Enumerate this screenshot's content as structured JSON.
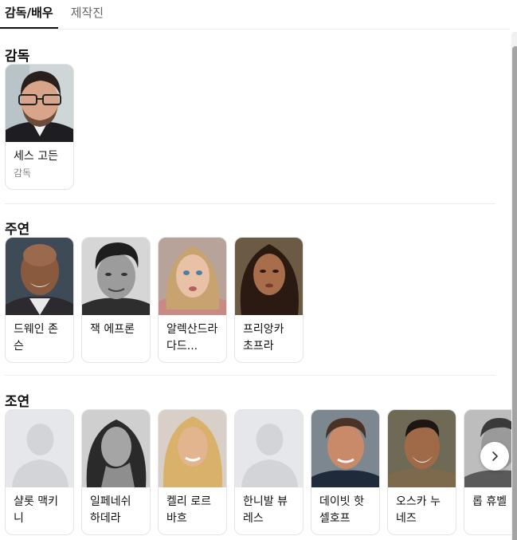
{
  "tabs": [
    {
      "label": "감독/배우"
    },
    {
      "label": "제작진"
    }
  ],
  "sections": {
    "director": {
      "title": "감독",
      "people": [
        {
          "name": "세스 고든",
          "role": "감독"
        }
      ]
    },
    "lead": {
      "title": "주연",
      "people": [
        {
          "name": "드웨인 존슨"
        },
        {
          "name": "잭 에프론"
        },
        {
          "name": "알렉산드라 다드..."
        },
        {
          "name": "프리앙카 초프라"
        }
      ]
    },
    "supporting": {
      "title": "조연",
      "people": [
        {
          "name": "샬롯 맥키니"
        },
        {
          "name": "일페네쉬 하데라"
        },
        {
          "name": "켈리 로르바흐"
        },
        {
          "name": "한니발 뷰레스"
        },
        {
          "name": "데이빗 핫셀호프"
        },
        {
          "name": "오스카 누네즈"
        },
        {
          "name": "롭 휴벨"
        }
      ]
    }
  },
  "icons": {
    "placeholder": "person-silhouette-icon",
    "next": "chevron-right-icon"
  },
  "colors": {
    "active_tab": "#111111",
    "divider": "#ececec",
    "placeholder_bg": "#e6e7ea"
  }
}
